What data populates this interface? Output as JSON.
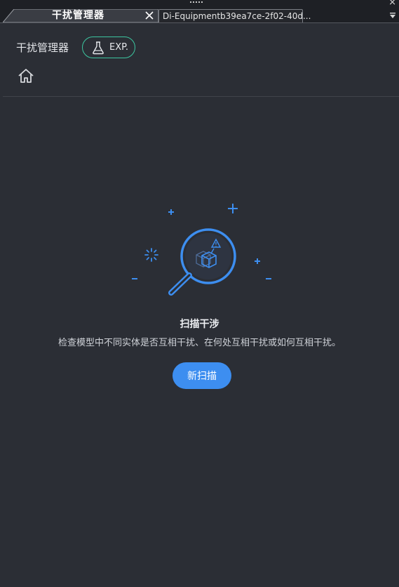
{
  "tabs": [
    {
      "label": "干扰管理器",
      "active": true
    },
    {
      "label": "Di-Equipmentb39ea7ce-2f02-40d...",
      "active": false
    }
  ],
  "header": {
    "title": "干扰管理器",
    "badge_label": "EXP."
  },
  "empty_state": {
    "title": "扫描干涉",
    "description": "检查模型中不同实体是否互相干扰、在何处互相干扰或如何互相干扰。",
    "button_label": "新扫描"
  },
  "icons": {
    "tab_close": "close-icon",
    "tab_menu": "dropdown-arrow-icon",
    "badge": "flask-icon",
    "home": "home-icon",
    "illustration": "magnifier-box-icon"
  },
  "colors": {
    "background": "#2b2e35",
    "accent_blue": "#3d8ef0",
    "badge_green": "#3cc6a0"
  }
}
